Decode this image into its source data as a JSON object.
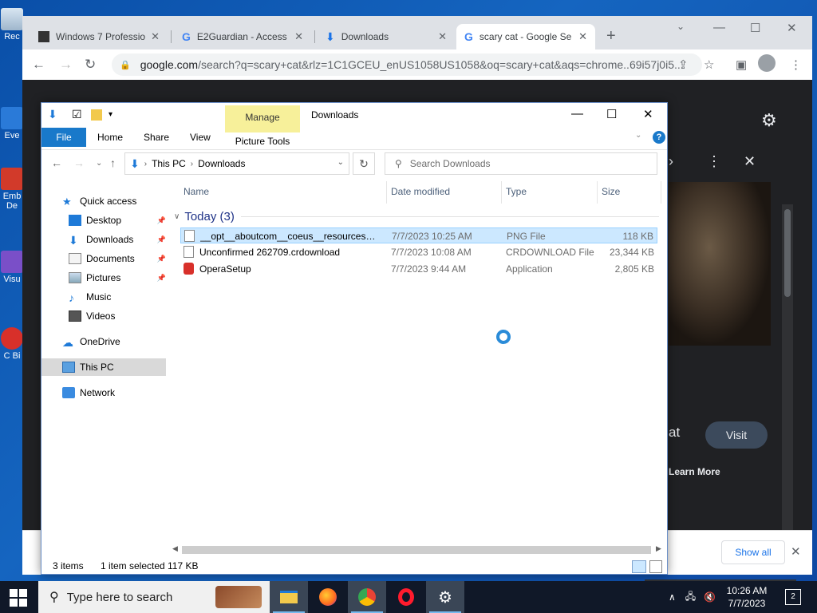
{
  "desktop": {
    "icons": [
      {
        "label": "Rec"
      },
      {
        "label": "Eve"
      },
      {
        "label": "Emb De"
      },
      {
        "label": "Visu"
      },
      {
        "label": "C Bi"
      }
    ]
  },
  "browser": {
    "tabs": [
      {
        "title": "Windows 7 Professio",
        "icon": "page-icon",
        "active": false
      },
      {
        "title": "E2Guardian - Access",
        "icon": "google-icon",
        "active": false
      },
      {
        "title": "Downloads",
        "icon": "download-icon",
        "active": false
      },
      {
        "title": "scary cat - Google Se",
        "icon": "google-icon",
        "active": true
      }
    ],
    "url_host": "google.com",
    "url_rest": "/search?q=scary+cat&rlz=1C1GCEU_enUS1058US1058&oq=scary+cat&aqs=chrome..69i57j0i5...",
    "panel": {
      "at_text": "at",
      "visit_label": "Visit",
      "learn_more_label": "Learn More"
    },
    "download_shelf": {
      "show_all_label": "Show all"
    }
  },
  "explorer": {
    "title": "Downloads",
    "manage_label": "Manage",
    "picture_tools_label": "Picture Tools",
    "ribbon_tabs": [
      "File",
      "Home",
      "Share",
      "View"
    ],
    "breadcrumb": [
      "This PC",
      "Downloads"
    ],
    "search_placeholder": "Search Downloads",
    "nav": [
      {
        "label": "Quick access",
        "icon": "star-icon",
        "pinned": false
      },
      {
        "label": "Desktop",
        "icon": "desktop-icon",
        "pinned": true
      },
      {
        "label": "Downloads",
        "icon": "download-icon",
        "pinned": true
      },
      {
        "label": "Documents",
        "icon": "documents-icon",
        "pinned": true
      },
      {
        "label": "Pictures",
        "icon": "pictures-icon",
        "pinned": true
      },
      {
        "label": "Music",
        "icon": "music-icon",
        "pinned": false
      },
      {
        "label": "Videos",
        "icon": "videos-icon",
        "pinned": false
      },
      {
        "label": "OneDrive",
        "icon": "cloud-icon",
        "pinned": false
      },
      {
        "label": "This PC",
        "icon": "computer-icon",
        "pinned": false,
        "selected": true
      },
      {
        "label": "Network",
        "icon": "network-icon",
        "pinned": false
      }
    ],
    "columns": {
      "name": "Name",
      "date": "Date modified",
      "type": "Type",
      "size": "Size"
    },
    "group_label": "Today (3)",
    "files": [
      {
        "name": "__opt__aboutcom__coeus__resources__co...",
        "date": "7/7/2023 10:25 AM",
        "type": "PNG File",
        "size": "118 KB",
        "selected": true
      },
      {
        "name": "Unconfirmed 262709.crdownload",
        "date": "7/7/2023 10:08 AM",
        "type": "CRDOWNLOAD File",
        "size": "23,344 KB",
        "selected": false
      },
      {
        "name": "OperaSetup",
        "date": "7/7/2023 9:44 AM",
        "type": "Application",
        "size": "2,805 KB",
        "selected": false
      }
    ],
    "status": {
      "items": "3 items",
      "selected": "1 item selected",
      "size": "117 KB"
    }
  },
  "taskbar": {
    "search_placeholder": "Type here to search",
    "apps": [
      "file-explorer-icon",
      "firefox-icon",
      "chrome-icon",
      "opera-icon",
      "settings-icon"
    ],
    "clock_time": "10:26 AM",
    "clock_date": "7/7/2023",
    "notification_count": "2"
  },
  "colors": {
    "desktop_bg": "#0d47a1",
    "explorer_accent": "#1979ca",
    "selection": "#cce8ff",
    "manage_tab": "#f7f09a",
    "taskbar": "#101828"
  }
}
